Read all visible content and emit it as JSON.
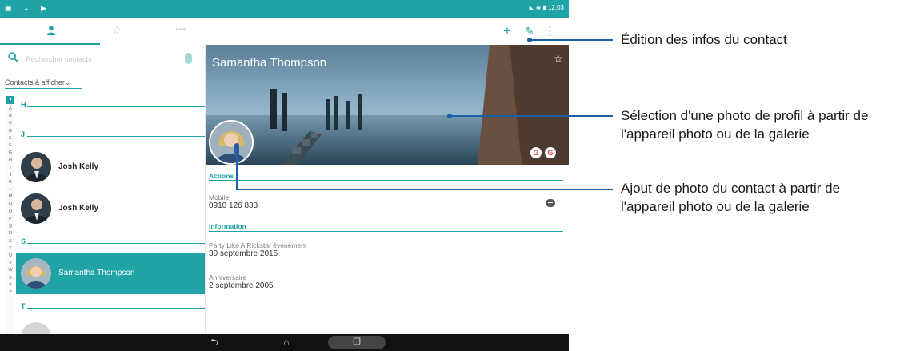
{
  "status_bar": {
    "left_icons": "▣ ⇣ ▶",
    "right_text": "◣ ◈ ▮ 12:03"
  },
  "top_bar": {
    "tabs": [
      {
        "name": "contacts",
        "icon": "person-icon",
        "glyph": "👤"
      },
      {
        "name": "favorites",
        "icon": "star-icon",
        "glyph": "☆"
      },
      {
        "name": "more",
        "icon": "more-icon",
        "glyph": "•••"
      }
    ],
    "actions": {
      "add": "+",
      "edit": "✎",
      "more": "⋮"
    }
  },
  "left_pane": {
    "search_placeholder": "Rechercher contacts",
    "filter_label": "Contacts à afficher",
    "filter_chevron": "⌄",
    "alphabet": [
      "A",
      "B",
      "C",
      "D",
      "E",
      "F",
      "G",
      "H",
      "I",
      "J",
      "K",
      "L",
      "M",
      "N",
      "O",
      "P",
      "Q",
      "R",
      "S",
      "T",
      "U",
      "V",
      "W",
      "X",
      "Y",
      "Z"
    ],
    "sections": {
      "h": "H",
      "j": "J",
      "s": "S",
      "t": "T"
    },
    "contacts": [
      {
        "name": "Josh Kelly"
      },
      {
        "name": "Josh Kelly"
      },
      {
        "name": "Samantha Thompson"
      }
    ]
  },
  "detail": {
    "name": "Samantha Thompson",
    "star": "☆",
    "google_badge": "G",
    "actions_header": "Actions",
    "mobile_label": "Mobile",
    "mobile_value": "0910 126 833",
    "information_header": "Information",
    "event_label": "Party Like A Rickstar événement",
    "event_value": "30 septembre 2015",
    "birthday_label": "Anniversaire",
    "birthday_value": "2 septembre 2005"
  },
  "nav_bar": {
    "back": "⮌",
    "home": "⌂",
    "recents": "❐"
  },
  "callouts": {
    "edit_contact": "Édition des infos du contact",
    "cover_photo_line1": "Sélection d'une photo de profil à partir de",
    "cover_photo_line2": "l'appareil photo ou de la galerie",
    "contact_photo_line1": "Ajout de photo du contact à partir de",
    "contact_photo_line2": "l'appareil photo ou de la galerie"
  },
  "colors": {
    "accent": "#1fa3a5",
    "callout": "#1b5fa8",
    "navbar": "#111111"
  }
}
